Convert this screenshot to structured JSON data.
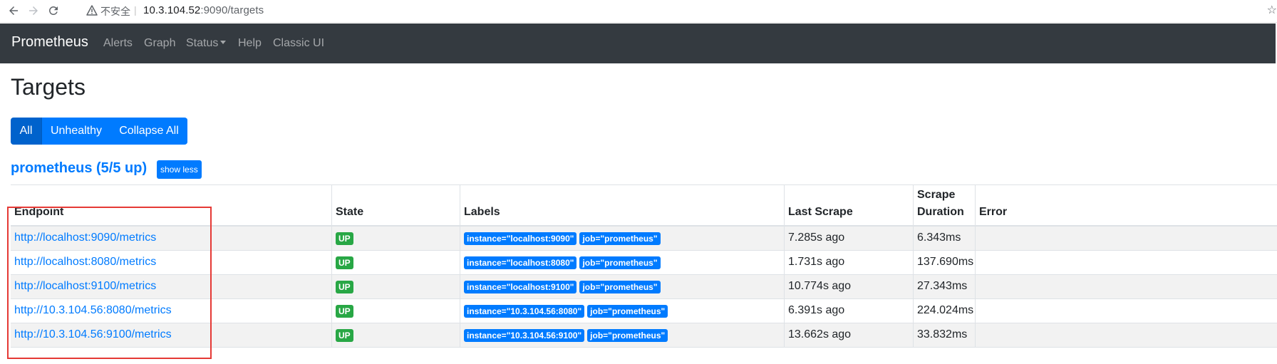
{
  "browser": {
    "insecure_label": "不安全",
    "url_host": "10.3.104.52",
    "url_rest": ":9090/targets"
  },
  "navbar": {
    "brand": "Prometheus",
    "items": [
      {
        "label": "Alerts"
      },
      {
        "label": "Graph"
      },
      {
        "label": "Status"
      },
      {
        "label": "Help"
      },
      {
        "label": "Classic UI"
      }
    ]
  },
  "page": {
    "title": "Targets",
    "filters": [
      {
        "label": "All",
        "active": true
      },
      {
        "label": "Unhealthy",
        "active": false
      },
      {
        "label": "Collapse All",
        "active": false
      }
    ]
  },
  "pool": {
    "title": "prometheus (5/5 up)",
    "toggle_label": "show less",
    "columns": [
      "Endpoint",
      "State",
      "Labels",
      "Last Scrape",
      "Scrape Duration",
      "Error"
    ],
    "rows": [
      {
        "endpoint": "http://localhost:9090/metrics",
        "state": "UP",
        "labels": [
          "instance=\"localhost:9090\"",
          "job=\"prometheus\""
        ],
        "last_scrape": "7.285s ago",
        "duration": "6.343ms",
        "error": ""
      },
      {
        "endpoint": "http://localhost:8080/metrics",
        "state": "UP",
        "labels": [
          "instance=\"localhost:8080\"",
          "job=\"prometheus\""
        ],
        "last_scrape": "1.731s ago",
        "duration": "137.690ms",
        "error": ""
      },
      {
        "endpoint": "http://localhost:9100/metrics",
        "state": "UP",
        "labels": [
          "instance=\"localhost:9100\"",
          "job=\"prometheus\""
        ],
        "last_scrape": "10.774s ago",
        "duration": "27.343ms",
        "error": ""
      },
      {
        "endpoint": "http://10.3.104.56:8080/metrics",
        "state": "UP",
        "labels": [
          "instance=\"10.3.104.56:8080\"",
          "job=\"prometheus\""
        ],
        "last_scrape": "6.391s ago",
        "duration": "224.024ms",
        "error": ""
      },
      {
        "endpoint": "http://10.3.104.56:9100/metrics",
        "state": "UP",
        "labels": [
          "instance=\"10.3.104.56:9100\"",
          "job=\"prometheus\""
        ],
        "last_scrape": "13.662s ago",
        "duration": "33.832ms",
        "error": ""
      }
    ]
  },
  "colors": {
    "navbar_bg": "#343a40",
    "primary": "#007bff",
    "primary_active": "#0062cc",
    "success": "#28a745",
    "highlight_box": "#e53935"
  }
}
